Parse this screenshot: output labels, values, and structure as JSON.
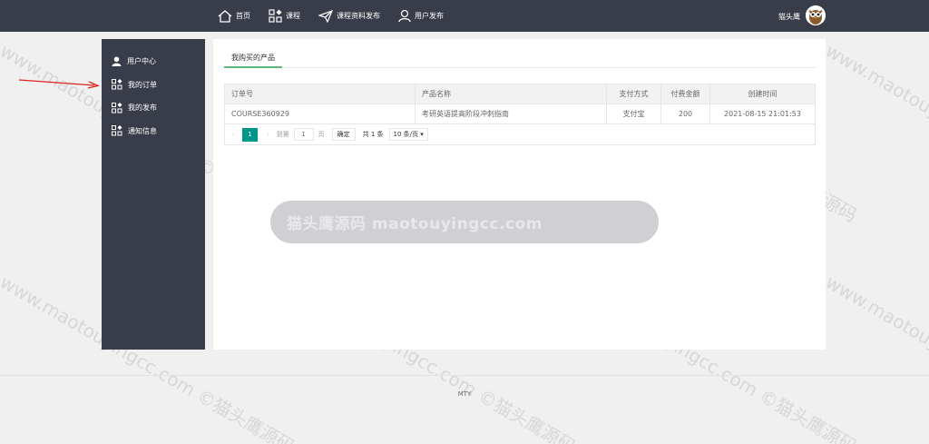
{
  "nav": {
    "items": [
      {
        "label": "首页",
        "icon": "home-icon"
      },
      {
        "label": "课程",
        "icon": "apps-icon"
      },
      {
        "label": "课程资料发布",
        "icon": "send-icon"
      },
      {
        "label": "用户发布",
        "icon": "user-icon"
      }
    ],
    "username": "猫头鹰"
  },
  "sidebar": {
    "items": [
      {
        "label": "用户中心",
        "icon": "user-icon"
      },
      {
        "label": "我的订单",
        "icon": "grid-icon"
      },
      {
        "label": "我的发布",
        "icon": "grid-icon"
      },
      {
        "label": "通知信息",
        "icon": "grid-icon"
      }
    ]
  },
  "main": {
    "tab": "我购买的产品",
    "table": {
      "headers": [
        "订单号",
        "产品名称",
        "支付方式",
        "付费金额",
        "创建时间"
      ],
      "rows": [
        [
          "COURSE360929",
          "考研英语提高阶段冲刺指南",
          "支付宝",
          "200",
          "2021-08-15 21:01:53"
        ]
      ]
    },
    "pager": {
      "current": "1",
      "goto_label": "到第",
      "goto_value": "1",
      "page_unit": "页",
      "confirm": "确定",
      "total": "共 1 条",
      "limit": "10 条/页"
    }
  },
  "watermark": {
    "pill": "猫头鹰源码 maotouyingcc.com",
    "repeat": "www.maotouyingcc.com ©猫头鹰源码"
  },
  "footer": {
    "text": "MTY"
  },
  "colors": {
    "topbar": "#393d49",
    "sidebar": "#393d49",
    "accent": "#009688",
    "tab_underline": "#5fb878"
  }
}
